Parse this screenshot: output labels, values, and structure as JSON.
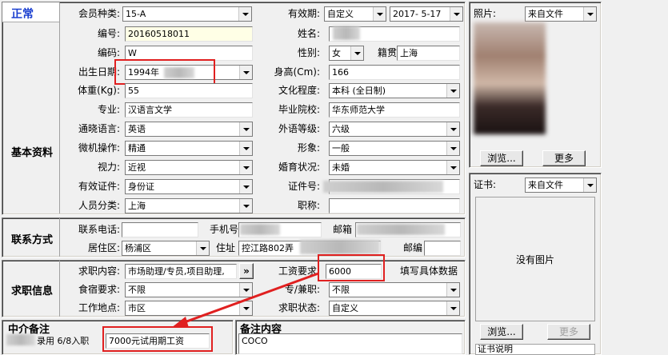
{
  "status": "正常",
  "labels": {
    "member_type": "会员种类:",
    "validity": "有效期:",
    "number": "编号:",
    "name": "姓名:",
    "code": "编码:",
    "gender": "性别:",
    "native": "籍贯",
    "birthdate": "出生日期:",
    "height": "身高(Cm):",
    "weight": "体重(Kg):",
    "education": "文化程度:",
    "major": "专业:",
    "school": "毕业院校:",
    "language": "通晓语言:",
    "foreign_level": "外语等级:",
    "computer": "微机操作:",
    "image": "形象:",
    "eyesight": "视力:",
    "marital": "婚育状况:",
    "id_doc": "有效证件:",
    "id_number": "证件号:",
    "category": "人员分类:",
    "title": "职称:",
    "tel": "联系电话:",
    "mobile": "手机号",
    "email": "邮箱",
    "area": "居住区:",
    "address": "住址",
    "postcode": "邮编",
    "job": "求职内容:",
    "salary": "工资要求:",
    "salary_hint": "填写具体数据",
    "board": "食宿要求:",
    "fulltime": "专/兼职:",
    "workplace": "工作地点:",
    "job_status": "求职状态:",
    "photo": "照片:",
    "cert": "证书:"
  },
  "sections": {
    "basic": "基本资料",
    "contact": "联系方式",
    "jobinfo": "求职信息",
    "agent_note": "中介备注",
    "note": "备注内容"
  },
  "values": {
    "member_type": "15-A",
    "validity_type": "自定义",
    "validity_date": "2017- 5-17",
    "number": "20160518011",
    "code": "W",
    "gender": "女",
    "native": "上海",
    "birthdate": "1994年",
    "height": "166",
    "weight": "55",
    "education": "本科 (全日制)",
    "major": "汉语言文学",
    "school": "华东师范大学",
    "language": "英语",
    "foreign_level": "六级",
    "computer": "精通",
    "image": "一般",
    "eyesight": "近视",
    "marital": "未婚",
    "id_doc": "身份证",
    "category": "上海",
    "area": "杨浦区",
    "address": "控江路802弄",
    "job": "市场助理/专员,项目助理,",
    "salary": "6000",
    "board": "不限",
    "fulltime": "不限",
    "workplace": "市区",
    "job_status": "自定义",
    "photo_source": "来自文件",
    "cert_source": "来自文件",
    "no_image": "没有图片",
    "agent_note_line": "录用  6/8入职",
    "agent_note_box": "7000元试用期工资",
    "note": "COCO",
    "cert_desc": "证书说明"
  },
  "buttons": {
    "browse": "浏览...",
    "more": "更多",
    "browse2": "浏览...",
    "more2": "更多",
    "job_more": "»"
  }
}
